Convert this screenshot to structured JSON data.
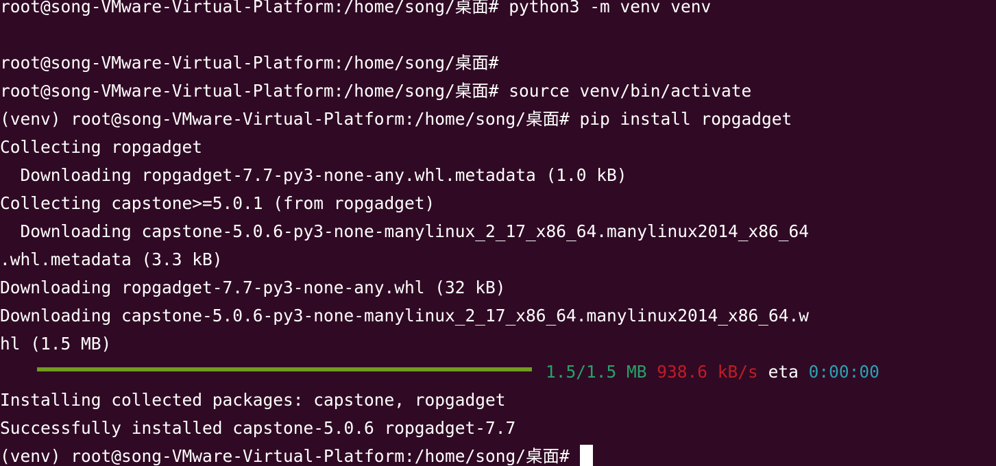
{
  "terminal": {
    "lines": [
      "root@song-VMware-Virtual-Platform:/home/song/桌面# python3 -m venv venv",
      "",
      "root@song-VMware-Virtual-Platform:/home/song/桌面#",
      "root@song-VMware-Virtual-Platform:/home/song/桌面# source venv/bin/activate",
      "(venv) root@song-VMware-Virtual-Platform:/home/song/桌面# pip install ropgadget",
      "Collecting ropgadget",
      "  Downloading ropgadget-7.7-py3-none-any.whl.metadata (1.0 kB)",
      "Collecting capstone>=5.0.1 (from ropgadget)",
      "  Downloading capstone-5.0.6-py3-none-manylinux_2_17_x86_64.manylinux2014_x86_64",
      ".whl.metadata (3.3 kB)",
      "Downloading ropgadget-7.7-py3-none-any.whl (32 kB)",
      "Downloading capstone-5.0.6-py3-none-manylinux_2_17_x86_64.manylinux2014_x86_64.w",
      "hl (1.5 MB)"
    ],
    "progress": {
      "fraction": 1.0,
      "size": "1.5/1.5 MB",
      "speed": "938.6 kB/s",
      "eta_label": "eta",
      "eta_value": "0:00:00"
    },
    "lines_after": [
      "Installing collected packages: capstone, ropgadget",
      "Successfully installed capstone-5.0.6 ropgadget-7.7"
    ],
    "prompt": "(venv) root@song-VMware-Virtual-Platform:/home/song/桌面# ",
    "colors": {
      "background": "#300a24",
      "foreground": "#ffffff",
      "progress_bar": "#729c1f",
      "size_text": "#26a269",
      "speed_text": "#c01c28",
      "eta_text": "#2aa1b3"
    }
  }
}
